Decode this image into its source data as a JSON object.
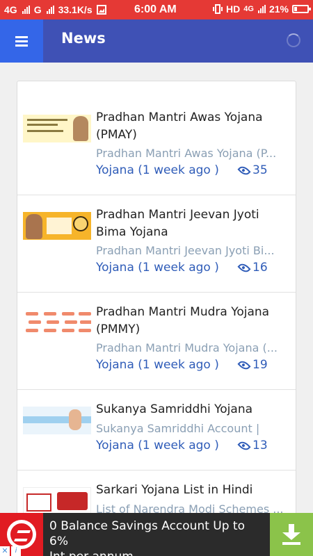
{
  "status_bar": {
    "network1": "4G",
    "network2": "G",
    "speed": "33.1K/s",
    "time": "6:00 AM",
    "hd": "HD",
    "network3": "4G",
    "battery_text": "21%",
    "battery_level": 0.21
  },
  "appbar": {
    "title": "News"
  },
  "news": [
    {
      "title": "Pradhan Mantri Awas Yojana (PMAY)",
      "subtitle": "Pradhan Mantri Awas Yojana (P...",
      "category": "Yojana",
      "time": "(1 week ago )",
      "views": "35"
    },
    {
      "title": "Pradhan Mantri Jeevan Jyoti Bima Yojana",
      "subtitle": "Pradhan Mantri Jeevan Jyoti Bi...",
      "category": "Yojana",
      "time": "(1 week ago )",
      "views": "16"
    },
    {
      "title": "Pradhan Mantri Mudra Yojana (PMMY)",
      "subtitle": "Pradhan Mantri Mudra Yojana (...",
      "category": "Yojana",
      "time": "(1 week ago )",
      "views": "19"
    },
    {
      "title": "Sukanya Samriddhi Yojana",
      "subtitle": "Sukanya Samriddhi Account |",
      "category": "Yojana",
      "time": "(1 week ago )",
      "views": "13"
    },
    {
      "title": "Sarkari Yojana List in Hindi",
      "subtitle": "List of Narendra Modi Schemes ..."
    }
  ],
  "ad": {
    "line1": "0 Balance Savings Account Up to 6%",
    "line2": "Int per annum",
    "close": "✕",
    "info": "i"
  }
}
